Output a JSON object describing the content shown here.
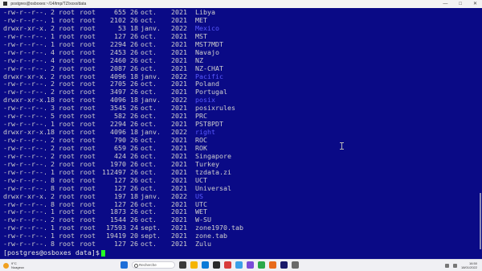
{
  "window": {
    "title": "postgres@osboxes:~/14/tmp/TZ/xxxx/data"
  },
  "colors": {
    "background": "#0a0a86",
    "foreground": "#cfcfcf",
    "directory": "#5a5aff",
    "cursor": "#24ff24"
  },
  "listing": [
    {
      "perm": "-rw-r--r--.",
      "links": "2",
      "owner": "root",
      "group": "root",
      "size": "655",
      "day": "26",
      "month": "oct.",
      "year": "2021",
      "name": "Libya",
      "is_dir": false
    },
    {
      "perm": "-rw-r--r--.",
      "links": "1",
      "owner": "root",
      "group": "root",
      "size": "2102",
      "day": "26",
      "month": "oct.",
      "year": "2021",
      "name": "MET",
      "is_dir": false
    },
    {
      "perm": "drwxr-xr-x.",
      "links": "2",
      "owner": "root",
      "group": "root",
      "size": "53",
      "day": "18",
      "month": "janv.",
      "year": "2022",
      "name": "Mexico",
      "is_dir": true
    },
    {
      "perm": "-rw-r--r--.",
      "links": "1",
      "owner": "root",
      "group": "root",
      "size": "127",
      "day": "26",
      "month": "oct.",
      "year": "2021",
      "name": "MST",
      "is_dir": false
    },
    {
      "perm": "-rw-r--r--.",
      "links": "1",
      "owner": "root",
      "group": "root",
      "size": "2294",
      "day": "26",
      "month": "oct.",
      "year": "2021",
      "name": "MST7MDT",
      "is_dir": false
    },
    {
      "perm": "-rw-r--r--.",
      "links": "4",
      "owner": "root",
      "group": "root",
      "size": "2453",
      "day": "26",
      "month": "oct.",
      "year": "2021",
      "name": "Navajo",
      "is_dir": false
    },
    {
      "perm": "-rw-r--r--.",
      "links": "4",
      "owner": "root",
      "group": "root",
      "size": "2460",
      "day": "26",
      "month": "oct.",
      "year": "2021",
      "name": "NZ",
      "is_dir": false
    },
    {
      "perm": "-rw-r--r--.",
      "links": "2",
      "owner": "root",
      "group": "root",
      "size": "2087",
      "day": "26",
      "month": "oct.",
      "year": "2021",
      "name": "NZ-CHAT",
      "is_dir": false
    },
    {
      "perm": "drwxr-xr-x.",
      "links": "2",
      "owner": "root",
      "group": "root",
      "size": "4096",
      "day": "18",
      "month": "janv.",
      "year": "2022",
      "name": "Pacific",
      "is_dir": true
    },
    {
      "perm": "-rw-r--r--.",
      "links": "2",
      "owner": "root",
      "group": "root",
      "size": "2705",
      "day": "26",
      "month": "oct.",
      "year": "2021",
      "name": "Poland",
      "is_dir": false
    },
    {
      "perm": "-rw-r--r--.",
      "links": "2",
      "owner": "root",
      "group": "root",
      "size": "3497",
      "day": "26",
      "month": "oct.",
      "year": "2021",
      "name": "Portugal",
      "is_dir": false
    },
    {
      "perm": "drwxr-xr-x.",
      "links": "18",
      "owner": "root",
      "group": "root",
      "size": "4096",
      "day": "18",
      "month": "janv.",
      "year": "2022",
      "name": "posix",
      "is_dir": true
    },
    {
      "perm": "-rw-r--r--.",
      "links": "3",
      "owner": "root",
      "group": "root",
      "size": "3545",
      "day": "26",
      "month": "oct.",
      "year": "2021",
      "name": "posixrules",
      "is_dir": false
    },
    {
      "perm": "-rw-r--r--.",
      "links": "5",
      "owner": "root",
      "group": "root",
      "size": "582",
      "day": "26",
      "month": "oct.",
      "year": "2021",
      "name": "PRC",
      "is_dir": false
    },
    {
      "perm": "-rw-r--r--.",
      "links": "1",
      "owner": "root",
      "group": "root",
      "size": "2294",
      "day": "26",
      "month": "oct.",
      "year": "2021",
      "name": "PST8PDT",
      "is_dir": false
    },
    {
      "perm": "drwxr-xr-x.",
      "links": "18",
      "owner": "root",
      "group": "root",
      "size": "4096",
      "day": "18",
      "month": "janv.",
      "year": "2022",
      "name": "right",
      "is_dir": true
    },
    {
      "perm": "-rw-r--r--.",
      "links": "2",
      "owner": "root",
      "group": "root",
      "size": "790",
      "day": "26",
      "month": "oct.",
      "year": "2021",
      "name": "ROC",
      "is_dir": false
    },
    {
      "perm": "-rw-r--r--.",
      "links": "2",
      "owner": "root",
      "group": "root",
      "size": "659",
      "day": "26",
      "month": "oct.",
      "year": "2021",
      "name": "ROK",
      "is_dir": false
    },
    {
      "perm": "-rw-r--r--.",
      "links": "2",
      "owner": "root",
      "group": "root",
      "size": "424",
      "day": "26",
      "month": "oct.",
      "year": "2021",
      "name": "Singapore",
      "is_dir": false
    },
    {
      "perm": "-rw-r--r--.",
      "links": "2",
      "owner": "root",
      "group": "root",
      "size": "1970",
      "day": "26",
      "month": "oct.",
      "year": "2021",
      "name": "Turkey",
      "is_dir": false
    },
    {
      "perm": "-rw-r--r--.",
      "links": "1",
      "owner": "root",
      "group": "root",
      "size": "112497",
      "day": "26",
      "month": "oct.",
      "year": "2021",
      "name": "tzdata.zi",
      "is_dir": false
    },
    {
      "perm": "-rw-r--r--.",
      "links": "8",
      "owner": "root",
      "group": "root",
      "size": "127",
      "day": "26",
      "month": "oct.",
      "year": "2021",
      "name": "UCT",
      "is_dir": false
    },
    {
      "perm": "-rw-r--r--.",
      "links": "8",
      "owner": "root",
      "group": "root",
      "size": "127",
      "day": "26",
      "month": "oct.",
      "year": "2021",
      "name": "Universal",
      "is_dir": false
    },
    {
      "perm": "drwxr-xr-x.",
      "links": "2",
      "owner": "root",
      "group": "root",
      "size": "197",
      "day": "18",
      "month": "janv.",
      "year": "2022",
      "name": "US",
      "is_dir": true
    },
    {
      "perm": "-rw-r--r--.",
      "links": "8",
      "owner": "root",
      "group": "root",
      "size": "127",
      "day": "26",
      "month": "oct.",
      "year": "2021",
      "name": "UTC",
      "is_dir": false
    },
    {
      "perm": "-rw-r--r--.",
      "links": "1",
      "owner": "root",
      "group": "root",
      "size": "1873",
      "day": "26",
      "month": "oct.",
      "year": "2021",
      "name": "WET",
      "is_dir": false
    },
    {
      "perm": "-rw-r--r--.",
      "links": "2",
      "owner": "root",
      "group": "root",
      "size": "1544",
      "day": "26",
      "month": "oct.",
      "year": "2021",
      "name": "W-SU",
      "is_dir": false
    },
    {
      "perm": "-rw-r--r--.",
      "links": "1",
      "owner": "root",
      "group": "root",
      "size": "17593",
      "day": "24",
      "month": "sept.",
      "year": "2021",
      "name": "zone1970.tab",
      "is_dir": false
    },
    {
      "perm": "-rw-r--r--.",
      "links": "1",
      "owner": "root",
      "group": "root",
      "size": "19419",
      "day": "20",
      "month": "sept.",
      "year": "2021",
      "name": "zone.tab",
      "is_dir": false
    },
    {
      "perm": "-rw-r--r--.",
      "links": "8",
      "owner": "root",
      "group": "root",
      "size": "127",
      "day": "26",
      "month": "oct.",
      "year": "2021",
      "name": "Zulu",
      "is_dir": false
    }
  ],
  "prompt": "[postgres@osboxes data]$",
  "taskbar": {
    "weather_temp": "9°C",
    "weather_desc": "Nuageux",
    "search_placeholder": "Recherche",
    "time": "16:50",
    "date": "18/01/2022"
  }
}
